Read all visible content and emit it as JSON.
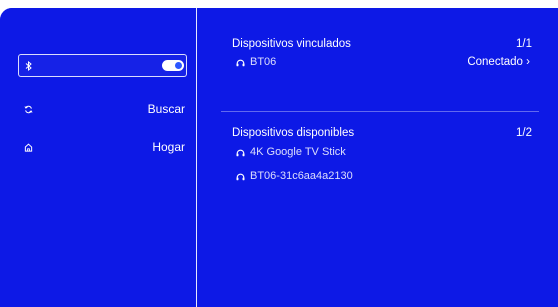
{
  "sidebar": {
    "items": [
      {
        "icon": "bluetooth-icon",
        "label": "",
        "toggle_on": true
      },
      {
        "icon": "refresh-icon",
        "label": "Buscar"
      },
      {
        "icon": "home-icon",
        "label": "Hogar"
      }
    ]
  },
  "paired": {
    "title": "Dispositivos vinculados",
    "count": "1/1",
    "devices": [
      {
        "icon": "headphones-icon",
        "name": "BT06",
        "status": "Conectado"
      }
    ]
  },
  "available": {
    "title": "Dispositivos disponibles",
    "count": "1/2",
    "devices": [
      {
        "icon": "headphones-icon",
        "name": "4K Google TV Stick"
      },
      {
        "icon": "headphones-icon",
        "name": "BT06-31c6aa4a2130"
      }
    ]
  },
  "colors": {
    "background": "#0d19e6",
    "text": "#ffffff",
    "toggle_knob": "#2d57ff"
  }
}
